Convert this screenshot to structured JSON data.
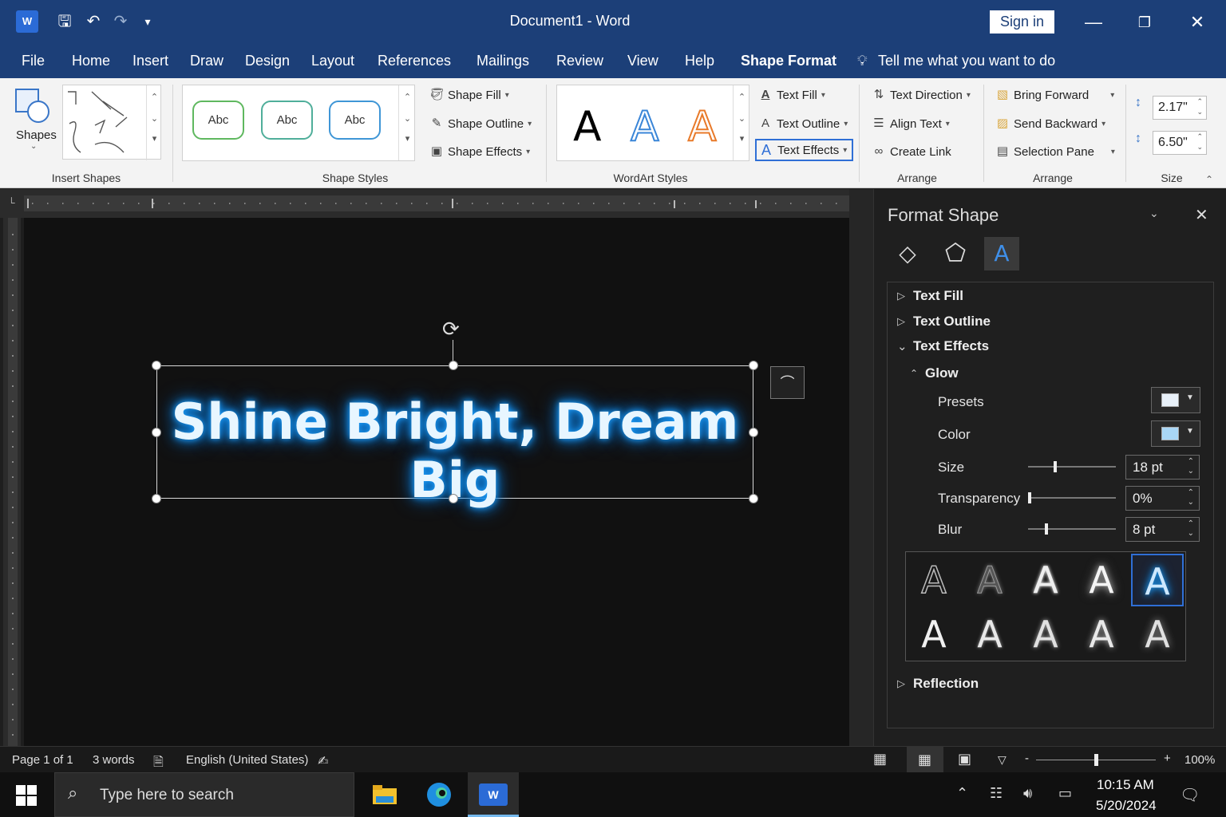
{
  "titlebar": {
    "title": "Document1  -  Word",
    "signin": "Sign in",
    "app_icon": "word-icon",
    "quick_access": [
      "save-icon",
      "undo-icon",
      "redo-icon",
      "customize-icon"
    ]
  },
  "menu": {
    "tabs": [
      "File",
      "Home",
      "Insert",
      "Draw",
      "Design",
      "Layout",
      "References",
      "Mailings",
      "Review",
      "View",
      "Help",
      "Shape Format"
    ],
    "active_tab": "Shape Format",
    "tell_me": "Tell me what you want to do"
  },
  "ribbon": {
    "shapes_label": "Shapes",
    "insert_shapes_label": "Insert Shapes",
    "shape_styles": {
      "sample": "Abc",
      "label": "Shape Styles",
      "items": [
        {
          "text": "Abc",
          "color": "#5fb85f"
        },
        {
          "text": "Abc",
          "color": "#4fae9a"
        },
        {
          "text": "Abc",
          "color": "#3f96d6"
        }
      ],
      "fill": "Shape Fill",
      "outline": "Shape Outline",
      "effects": "Shape Effects"
    },
    "wordart": {
      "label": "WordArt Styles",
      "sample": "A",
      "text_fill": "Text Fill",
      "text_outline": "Text Outline",
      "text_effects": "Text Effects"
    },
    "text_group": {
      "direction": "Text Direction",
      "align": "Align Text",
      "create_link": "Create Link",
      "label": "Arrange"
    },
    "arrange": {
      "bring_forward": "Bring Forward",
      "send_backward": "Send Backward",
      "selection_pane": "Selection Pane",
      "label": "Arrange"
    },
    "size": {
      "height": "2.17\"",
      "width": "6.50\"",
      "label": "Size"
    }
  },
  "document": {
    "text": "Shine Bright, Dream Big",
    "glow_color": "#1fa2ff"
  },
  "pane": {
    "title": "Format Shape",
    "tabs": [
      "fill-line-icon",
      "shape-effects-icon",
      "text-options-icon"
    ],
    "sections": {
      "text_fill": "Text Fill",
      "text_outline": "Text Outline",
      "text_effects": "Text Effects",
      "glow": "Glow",
      "reflection": "Reflection"
    },
    "glow": {
      "presets_label": "Presets",
      "color_label": "Color",
      "color": "#a9d6f5",
      "size_label": "Size",
      "size": "18 pt",
      "size_level": 0.3,
      "transparency_label": "Transparency",
      "transparency": "0%",
      "transparency_level": 0.0,
      "blur_label": "Blur",
      "blur": "8 pt",
      "blur_level": 0.2
    },
    "gallery": {
      "glyph": "A",
      "selected_index": 4
    }
  },
  "status": {
    "page": "Page 1 of 1",
    "words": "3 words",
    "language": "English (United States)",
    "zoom": "100%",
    "zoom_level": 0.5
  },
  "taskbar": {
    "search_placeholder": "Type here to search",
    "time": "10:15 AM",
    "date": "5/20/2024"
  }
}
